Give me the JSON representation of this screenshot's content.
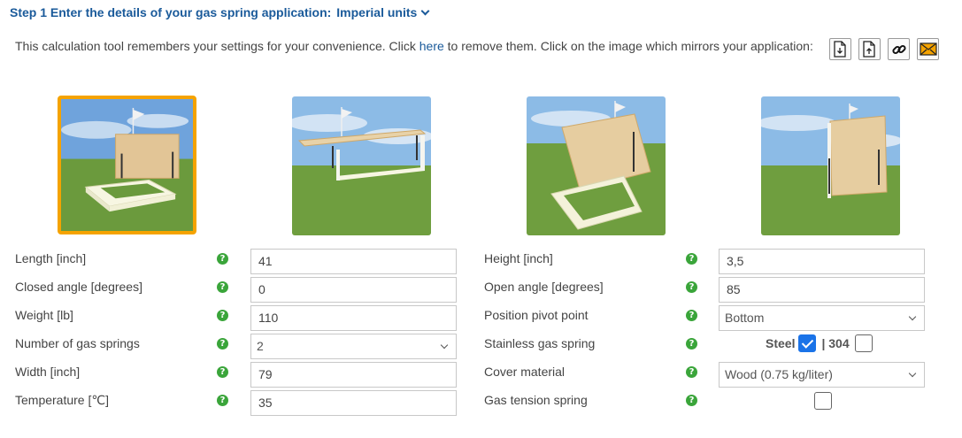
{
  "header": {
    "step_title": "Step 1 Enter the details of your gas spring application:",
    "units_label": "Imperial units"
  },
  "intro": {
    "text_before": "This calculation tool remembers your settings for your convenience. Click ",
    "link_text": "here",
    "text_after": " to remove them. Click on the image which mirrors your application:"
  },
  "toolbar": {
    "icons": [
      "document-download-icon",
      "document-upload-icon",
      "link-icon",
      "envelope-icon"
    ]
  },
  "applications": [
    {
      "name": "horizontal-lid-up",
      "selected": true
    },
    {
      "name": "table-top",
      "selected": false
    },
    {
      "name": "tilted-lid",
      "selected": false
    },
    {
      "name": "vertical-panel",
      "selected": false
    }
  ],
  "form": {
    "length": {
      "label": "Length [inch]",
      "value": "41"
    },
    "closed_angle": {
      "label": "Closed angle [degrees]",
      "value": "0"
    },
    "weight": {
      "label": "Weight [lb]",
      "value": "110"
    },
    "num_springs": {
      "label": "Number of gas springs",
      "value": "2"
    },
    "width": {
      "label": "Width [inch]",
      "value": "79"
    },
    "temperature": {
      "label": "Temperature [℃]",
      "value": "35"
    },
    "height": {
      "label": "Height [inch]",
      "value": "3,5"
    },
    "open_angle": {
      "label": "Open angle [degrees]",
      "value": "85"
    },
    "pivot": {
      "label": "Position pivot point",
      "value": "Bottom"
    },
    "stainless": {
      "label": "Stainless gas spring",
      "steel_label": "Steel",
      "steel_checked": true,
      "separator": "| 304",
      "s304_checked": false
    },
    "cover": {
      "label": "Cover material",
      "value": "Wood (0.75 kg/liter)"
    },
    "gas_tension": {
      "label": "Gas tension spring",
      "checked": false
    }
  },
  "help_glyph": "?",
  "colors": {
    "brand_blue": "#1a5a9a",
    "selected_border": "#f5a300",
    "help_green": "#3aa53a",
    "checkbox_blue": "#1a73e8"
  }
}
